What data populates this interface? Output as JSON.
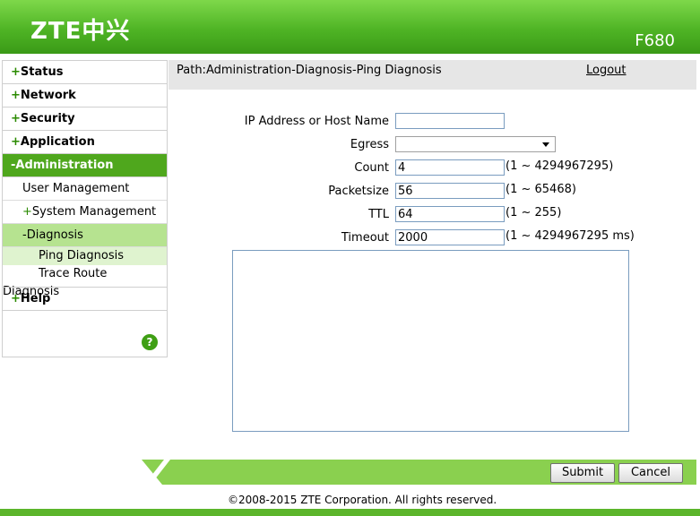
{
  "header": {
    "logo": "ZTE中兴",
    "model": "F680"
  },
  "sidebar": {
    "top": [
      {
        "sign": "+",
        "label": "Status"
      },
      {
        "sign": "+",
        "label": "Network"
      },
      {
        "sign": "+",
        "label": "Security"
      },
      {
        "sign": "+",
        "label": "Application"
      },
      {
        "sign": "-",
        "label": "Administration"
      },
      {
        "sign": "+",
        "label": "Help"
      }
    ],
    "admin_sub": [
      {
        "sign": "",
        "label": "User Management"
      },
      {
        "sign": "+",
        "label": "System Management"
      },
      {
        "sign": "-",
        "label": "Diagnosis"
      }
    ],
    "diagnosis_sub": [
      {
        "label": "Ping Diagnosis"
      },
      {
        "label": "Trace Route Diagnosis"
      }
    ],
    "help_icon": "?"
  },
  "pathbar": {
    "path": "Path:Administration-Diagnosis-Ping Diagnosis",
    "logout": "Logout"
  },
  "form": {
    "host_label": "IP Address or Host Name",
    "host_value": "",
    "egress_label": "Egress",
    "egress_value": "",
    "count_label": "Count",
    "count_value": "4",
    "count_range": "(1 ~ 4294967295)",
    "packetsize_label": "Packetsize",
    "packetsize_value": "56",
    "packetsize_range": "(1 ~ 65468)",
    "ttl_label": "TTL",
    "ttl_value": "64",
    "ttl_range": "(1 ~ 255)",
    "timeout_label": "Timeout",
    "timeout_value": "2000",
    "timeout_range": "(1 ~ 4294967295 ms)",
    "result_text": ""
  },
  "buttons": {
    "submit": "Submit",
    "cancel": "Cancel"
  },
  "footer": {
    "copyright": "©2008-2015 ZTE Corporation. All rights reserved."
  },
  "colors": {
    "brand_green": "#4fa71d",
    "selected_sub": "#b6e390",
    "selected_third": "#dff3cf"
  }
}
